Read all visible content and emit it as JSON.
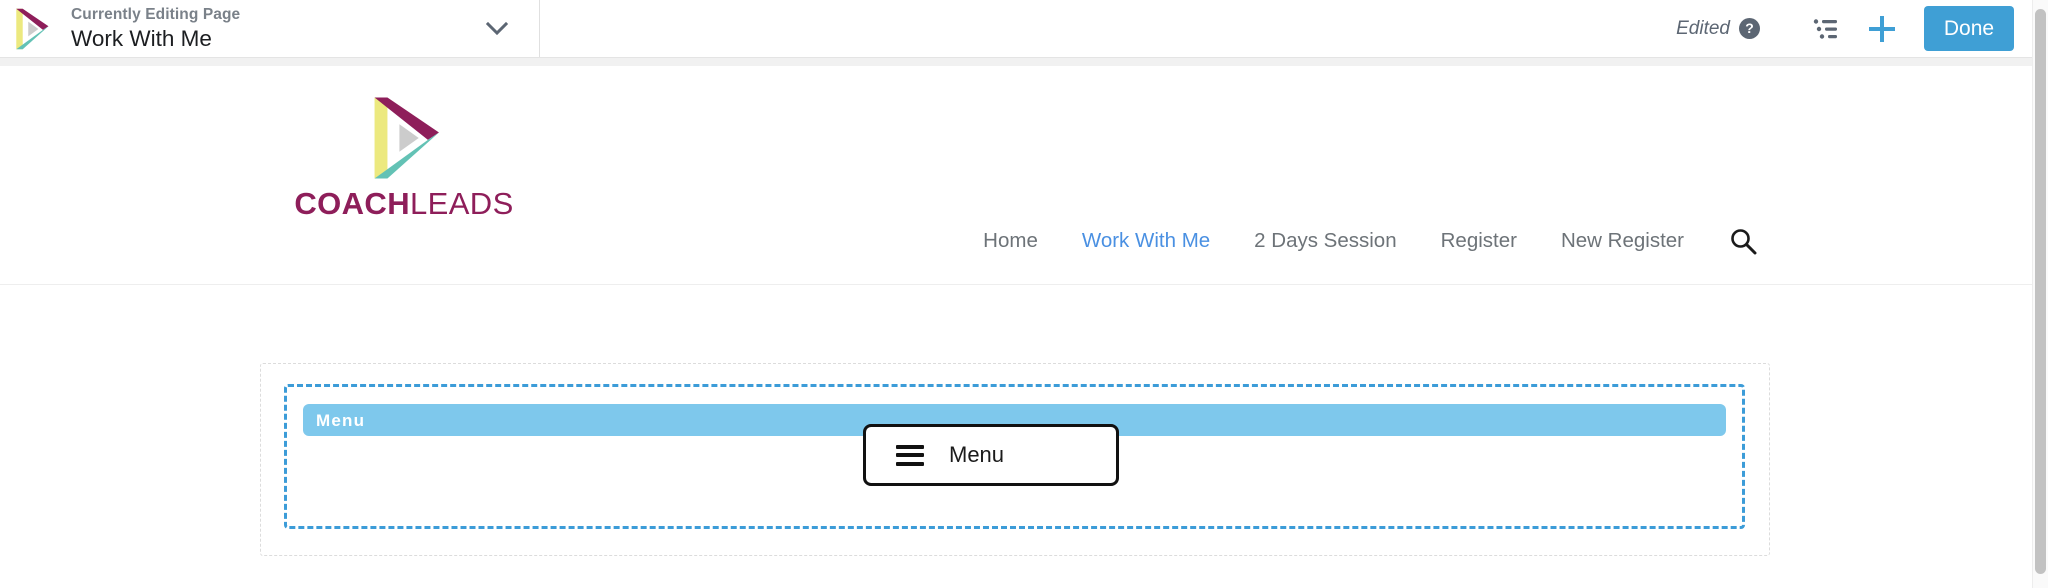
{
  "editor": {
    "page_selector": {
      "label": "Currently Editing Page",
      "page_title": "Work With Me",
      "chevron_icon": "chevron-down-icon"
    },
    "status": {
      "edited_text": "Edited",
      "help_icon": "?"
    },
    "toolbar": {
      "outline_icon": "outline-list-icon",
      "add_icon": "plus-icon",
      "done_label": "Done"
    }
  },
  "site": {
    "brand": {
      "name_bold": "COACH",
      "name_light": "LEADS",
      "logo_icon": "coachleads-triangle-play-logo"
    },
    "nav": {
      "items": [
        {
          "label": "Home",
          "active": false
        },
        {
          "label": "Work With Me",
          "active": true
        },
        {
          "label": "2 Days Session",
          "active": false
        },
        {
          "label": "Register",
          "active": false
        },
        {
          "label": "New Register",
          "active": false
        }
      ],
      "search_icon": "search-icon"
    }
  },
  "widget": {
    "section_label": "Menu",
    "button_label": "Menu",
    "button_icon": "hamburger-icon"
  },
  "colors": {
    "accent_blue": "#3f9fd5",
    "nav_active": "#4a90e2",
    "widget_band": "#7ec8ec",
    "widget_border": "#3c9cd8",
    "brand_magenta": "#8e1e5a",
    "brand_yellow": "#ece97f",
    "brand_teal": "#63c2b5"
  }
}
